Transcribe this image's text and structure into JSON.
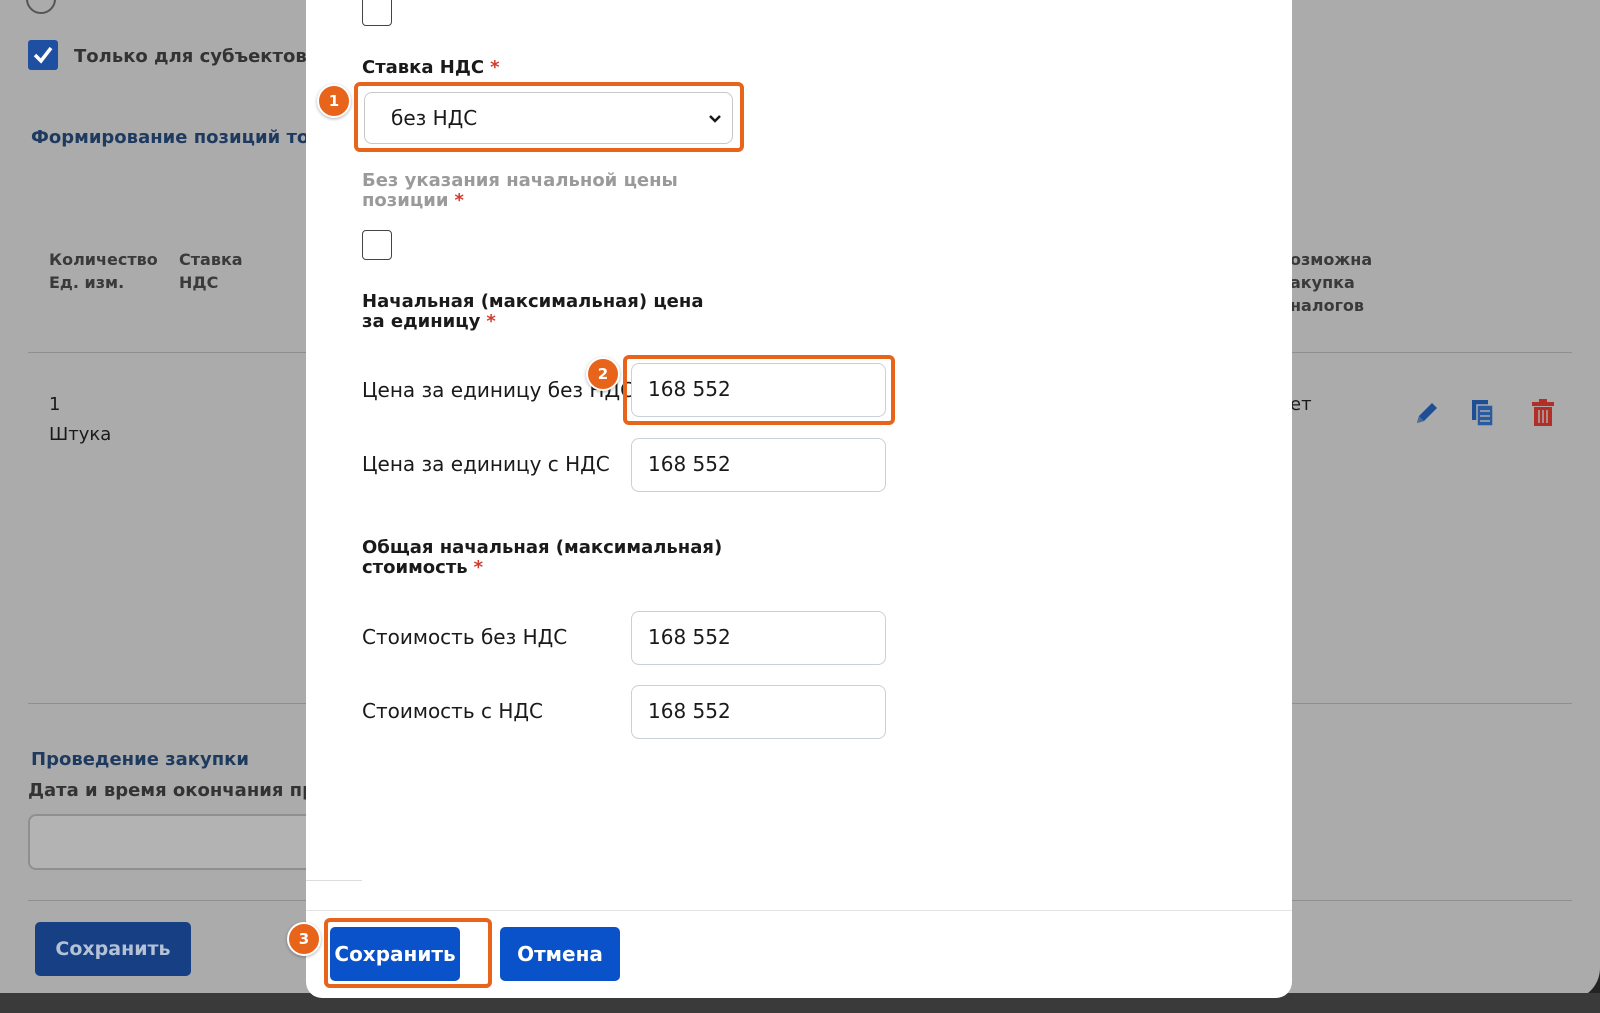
{
  "background": {
    "smsp_checkbox_label": "Только для субъектов м",
    "positions_heading": "Формирование позиций то",
    "table_headers": {
      "quantity": "Количество",
      "unit": "Ед. изм.",
      "vat_line1": "Ставка",
      "vat_line2": "НДС",
      "analog_line1": "озможна",
      "analog_line2": "акупка",
      "analog_line3": "налогов"
    },
    "row": {
      "quantity": "1",
      "unit": "Штука",
      "analog": "ет"
    },
    "procurement_heading": "Проведение закупки",
    "end_date_label": "Дата и время окончания пр",
    "save_button": "Сохранить",
    "colors": {
      "dark_blue": "#163f84",
      "delete_red": "#b32e26"
    }
  },
  "modal": {
    "vat_rate_label": "Ставка НДС",
    "vat_rate_value": "без НДС",
    "no_start_price_label_line1": "Без указания начальной цены",
    "no_start_price_label_line2": "позиции",
    "unit_price_heading_line1": "Начальная (максимальная) цена",
    "unit_price_heading_line2": "за единицу",
    "unit_price_no_vat_label": "Цена за единицу без НДС",
    "unit_price_no_vat_value": "168 552",
    "unit_price_with_vat_label": "Цена за единицу с НДС",
    "unit_price_with_vat_value": "168 552",
    "total_heading_line1": "Общая начальная (максимальная)",
    "total_heading_line2": "стоимость",
    "total_no_vat_label": "Стоимость без НДС",
    "total_no_vat_value": "168 552",
    "total_with_vat_label": "Стоимость с НДС",
    "total_with_vat_value": "168 552",
    "save_button": "Сохранить",
    "cancel_button": "Отмена",
    "required_mark": "*",
    "colors": {
      "primary": "#0a52c9",
      "required": "#d43a2c"
    }
  },
  "annotations": {
    "markers": [
      "1",
      "2",
      "3"
    ],
    "color": "#e8641b"
  }
}
